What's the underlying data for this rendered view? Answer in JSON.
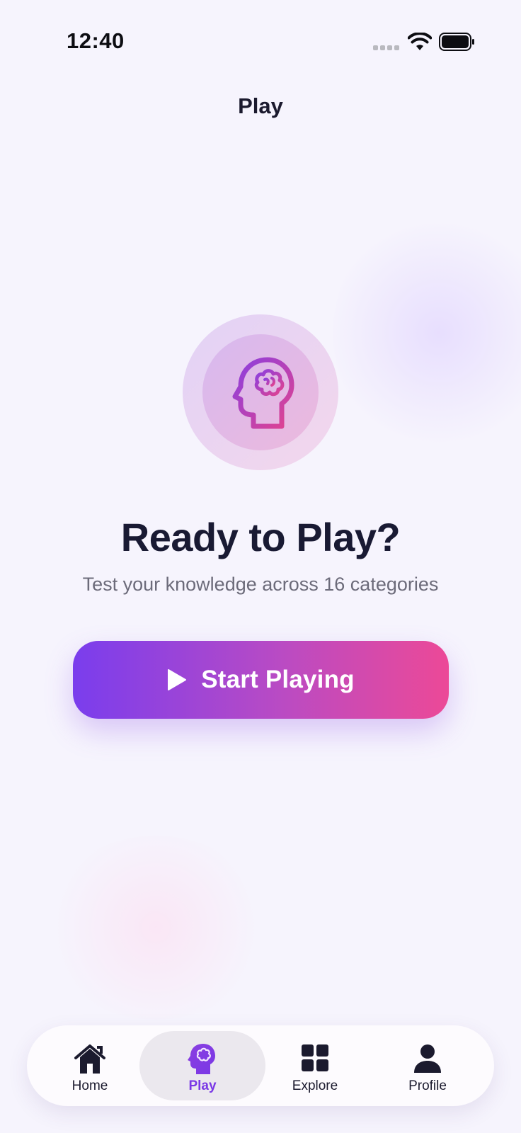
{
  "status_bar": {
    "time": "12:40",
    "icons": [
      "signal-icon",
      "wifi-icon",
      "battery-icon"
    ]
  },
  "header": {
    "title": "Play"
  },
  "hero": {
    "icon": "brain-head-icon",
    "headline": "Ready to Play?",
    "subtext": "Test your knowledge across 16 categories"
  },
  "cta": {
    "icon": "play-icon",
    "label": "Start Playing"
  },
  "tab_bar": {
    "items": [
      {
        "label": "Home",
        "icon": "home-icon",
        "active": false
      },
      {
        "label": "Play",
        "icon": "brain-head-icon",
        "active": true
      },
      {
        "label": "Explore",
        "icon": "grid-icon",
        "active": false
      },
      {
        "label": "Profile",
        "icon": "person-icon",
        "active": false
      }
    ]
  },
  "colors": {
    "background": "#f6f4fd",
    "accent_purple": "#7a3ded",
    "accent_pink": "#ec4997",
    "text_dark": "#191a33",
    "text_muted": "#6c6b7a"
  }
}
